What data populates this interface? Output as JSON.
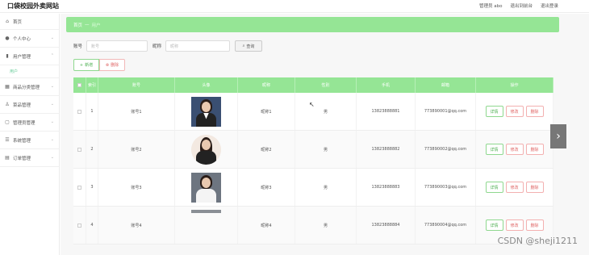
{
  "brand": "口袋校园外卖网站",
  "topbar": {
    "user": "管理员 abo",
    "exit_front": "退出到前台",
    "logout": "退出登录"
  },
  "sidebar": {
    "items": [
      {
        "label": "首页",
        "icon": "home-icon"
      },
      {
        "label": "个人中心",
        "icon": "user-icon"
      },
      {
        "label": "用户管理",
        "icon": "bar-chart-icon"
      },
      {
        "label": "商品分类管理",
        "icon": "grid-icon"
      },
      {
        "label": "菜品管理",
        "icon": "person-icon"
      },
      {
        "label": "管理员管理",
        "icon": "chat-icon"
      },
      {
        "label": "系统管理",
        "icon": "list-icon"
      },
      {
        "label": "订单管理",
        "icon": "order-icon"
      }
    ],
    "sub_item": "用户"
  },
  "breadcrumb": {
    "home": "首页",
    "sep": "—",
    "current": "用户"
  },
  "search": {
    "account_label": "账号",
    "account_placeholder": "账号",
    "nickname_label": "昵称",
    "nickname_placeholder": "昵称",
    "search_button": "查询"
  },
  "actions": {
    "add": "新增",
    "delete": "删除"
  },
  "table": {
    "headers": [
      "",
      "索引",
      "账号",
      "头像",
      "昵称",
      "性别",
      "手机",
      "邮箱",
      "操作"
    ],
    "rows": [
      {
        "index": "1",
        "account": "账号1",
        "nickname": "昵称1",
        "sex": "男",
        "phone": "13823888881",
        "email": "773890001@qq.com"
      },
      {
        "index": "2",
        "account": "账号2",
        "nickname": "昵称2",
        "sex": "男",
        "phone": "13823888882",
        "email": "773890002@qq.com"
      },
      {
        "index": "3",
        "account": "账号3",
        "nickname": "昵称3",
        "sex": "男",
        "phone": "13823888883",
        "email": "773890003@qq.com"
      },
      {
        "index": "4",
        "account": "账号4",
        "nickname": "昵称4",
        "sex": "男",
        "phone": "13823888884",
        "email": "773890004@qq.com"
      }
    ],
    "op_detail": "详情",
    "op_edit": "修改",
    "op_delete": "删除"
  },
  "watermark": "CSDN @sheji1211"
}
